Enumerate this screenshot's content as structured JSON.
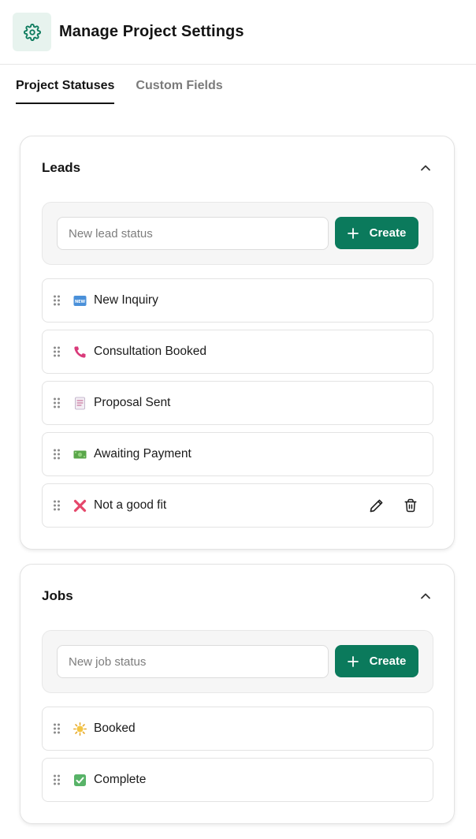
{
  "header": {
    "title": "Manage Project Settings",
    "icon": "gear-icon",
    "accent_color": "#0b7a5c"
  },
  "tabs": [
    {
      "label": "Project Statuses",
      "active": true
    },
    {
      "label": "Custom Fields",
      "active": false
    }
  ],
  "leads": {
    "title": "Leads",
    "input_placeholder": "New lead status",
    "create_label": "Create",
    "statuses": [
      {
        "label": "New Inquiry",
        "icon": "new-badge-icon"
      },
      {
        "label": "Consultation Booked",
        "icon": "phone-icon"
      },
      {
        "label": "Proposal Sent",
        "icon": "document-icon"
      },
      {
        "label": "Awaiting Payment",
        "icon": "cash-icon"
      },
      {
        "label": "Not a good fit",
        "icon": "cross-mark-icon"
      }
    ]
  },
  "jobs": {
    "title": "Jobs",
    "input_placeholder": "New job status",
    "create_label": "Create",
    "statuses": [
      {
        "label": "Booked",
        "icon": "sun-icon"
      },
      {
        "label": "Complete",
        "icon": "check-mark-icon"
      }
    ]
  }
}
